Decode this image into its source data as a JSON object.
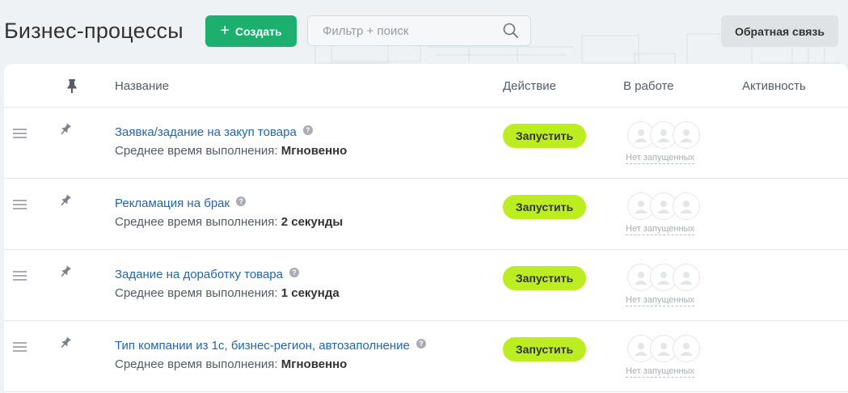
{
  "header": {
    "title": "Бизнес-процессы",
    "create_label": "Создать",
    "search_placeholder": "Фильтр + поиск",
    "feedback_label": "Обратная связь"
  },
  "table": {
    "columns": {
      "name": "Название",
      "action": "Действие",
      "in_work": "В работе",
      "activity": "Активность"
    },
    "rows": [
      {
        "title": "Заявка/задание на закуп товара",
        "time_label": "Среднее время выполнения:",
        "time_value": "Мгновенно",
        "run_label": "Запустить",
        "status": "Нет запущенных"
      },
      {
        "title": "Рекламация на брак",
        "time_label": "Среднее время выполнения:",
        "time_value": "2 секунды",
        "run_label": "Запустить",
        "status": "Нет запущенных"
      },
      {
        "title": "Задание на доработку товара",
        "time_label": "Среднее время выполнения:",
        "time_value": "1 секунда",
        "run_label": "Запустить",
        "status": "Нет запущенных"
      },
      {
        "title": "Тип компании из 1с, бизнес-регион, автозаполнение",
        "time_label": "Среднее время выполнения:",
        "time_value": "Мгновенно",
        "run_label": "Запустить",
        "status": "Нет запущенных"
      }
    ]
  },
  "colors": {
    "create_button": "#1daf6e",
    "run_button": "#bbed21",
    "link": "#2067b0"
  }
}
